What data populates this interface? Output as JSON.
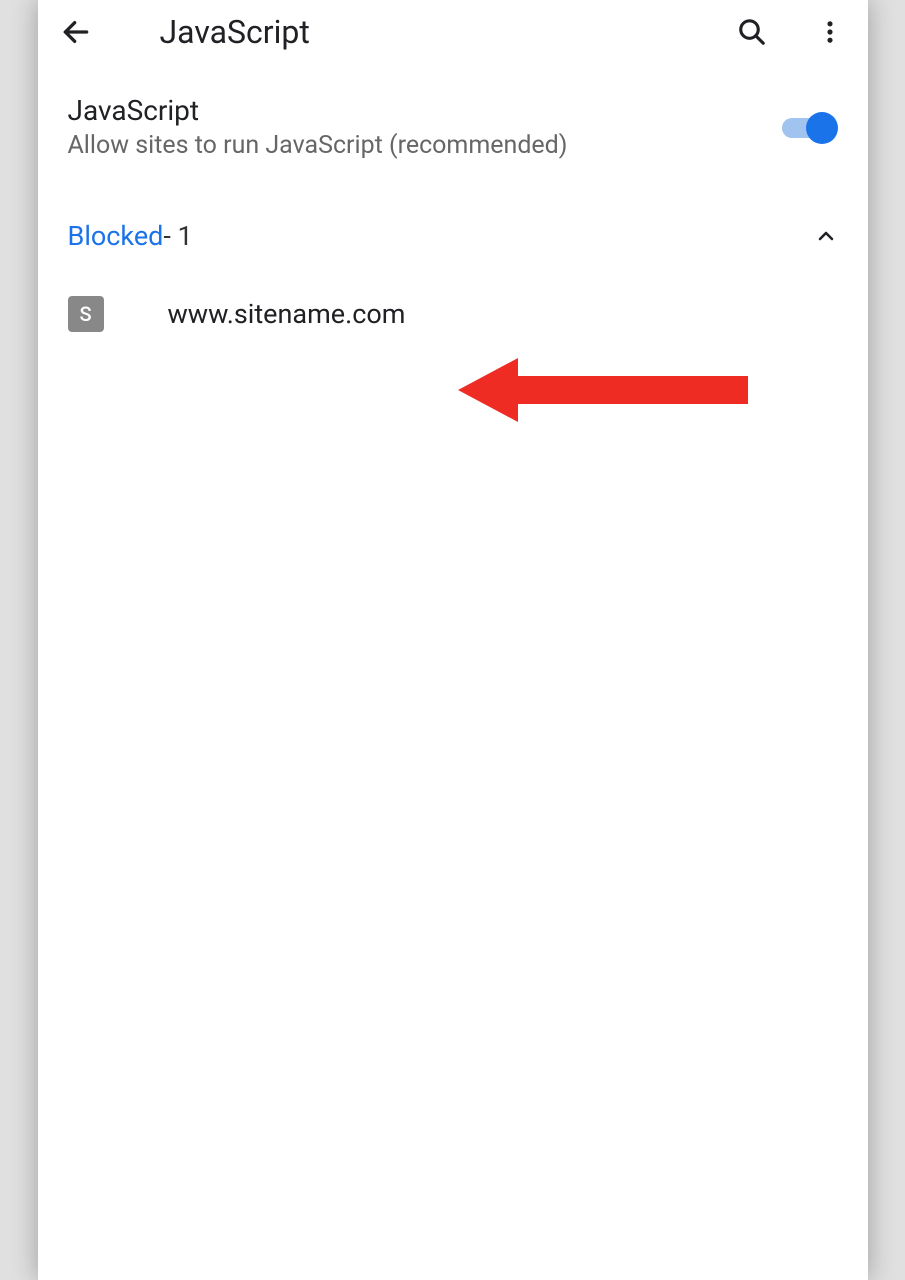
{
  "header": {
    "title": "JavaScript"
  },
  "setting": {
    "title": "JavaScript",
    "subtitle": "Allow sites to run JavaScript (recommended)",
    "enabled": true
  },
  "section": {
    "label": "Blocked",
    "count_suffix": " - 1"
  },
  "sites": [
    {
      "favicon_letter": "S",
      "url": "www.sitename.com"
    }
  ]
}
